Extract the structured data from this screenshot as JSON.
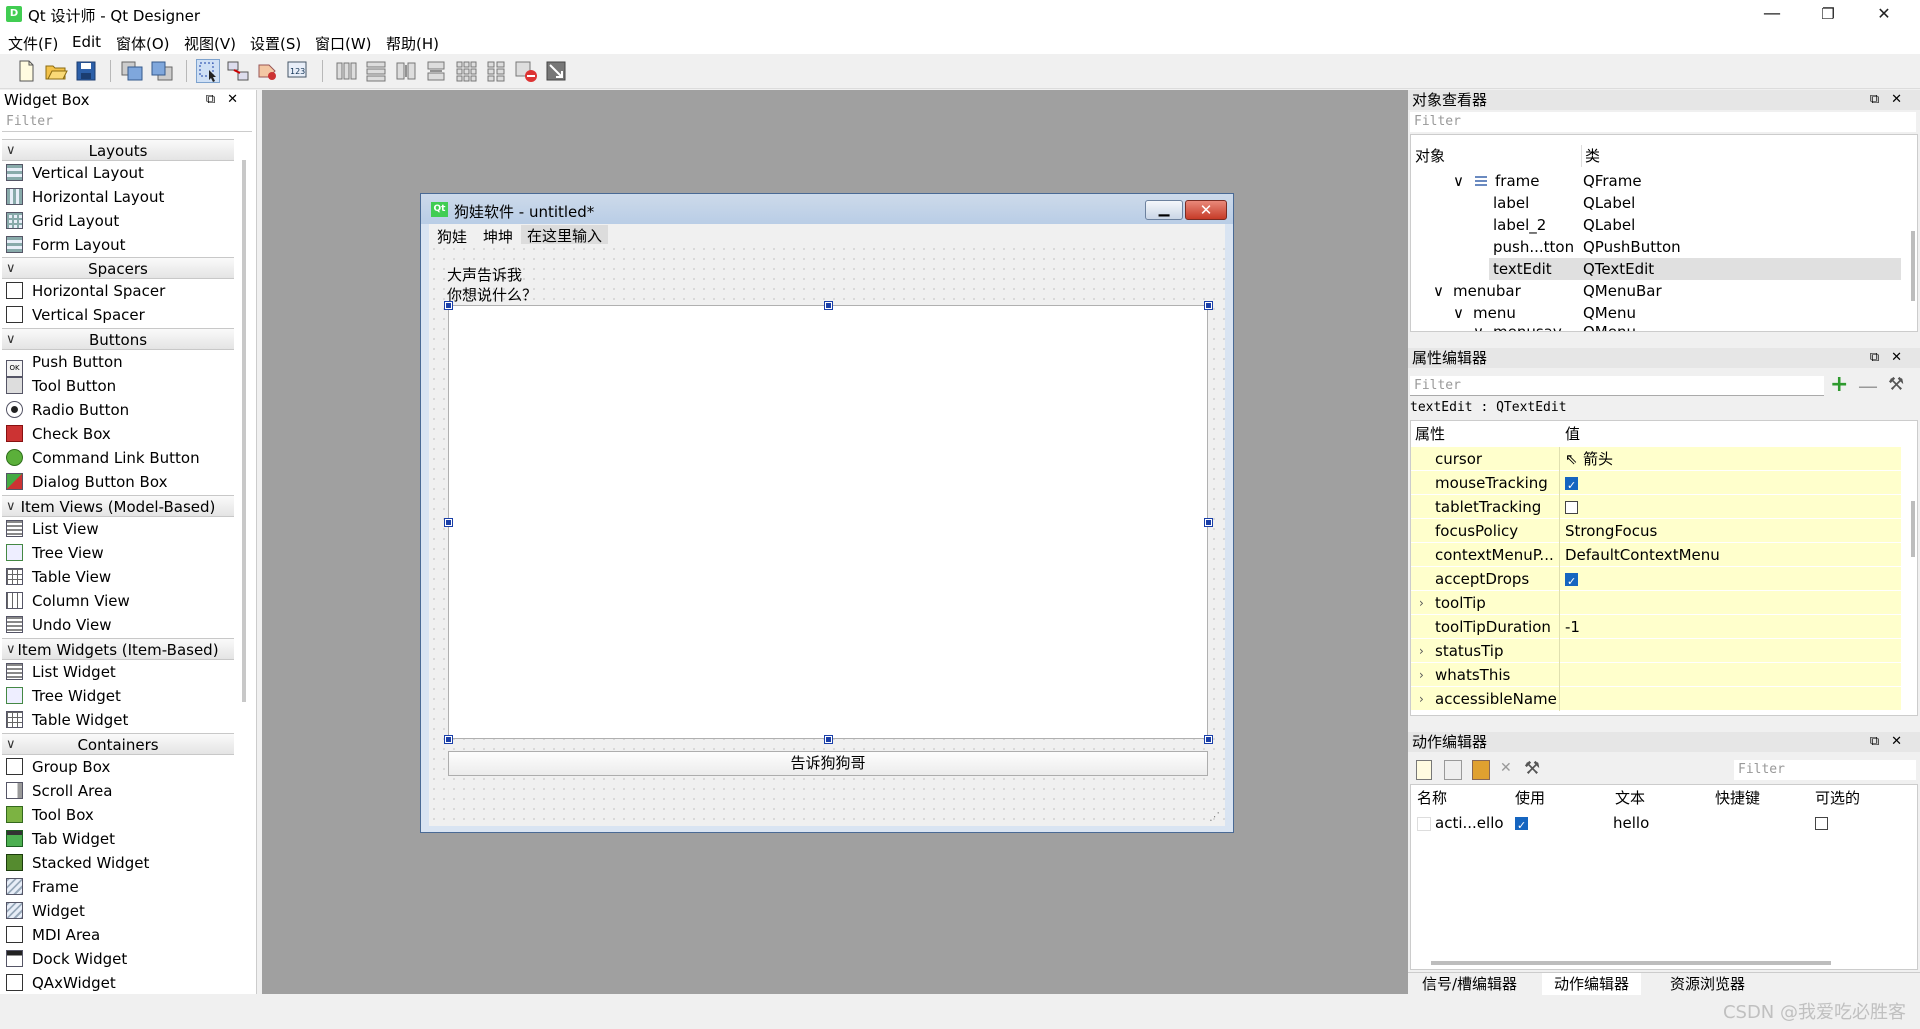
{
  "window": {
    "title": "Qt 设计师 - Qt Designer",
    "icon": "D",
    "minimize": "—",
    "restore": "❐",
    "close": "✕"
  },
  "menu": [
    "文件(F)",
    "Edit",
    "窗体(O)",
    "视图(V)",
    "设置(S)",
    "窗口(W)",
    "帮助(H)"
  ],
  "widget_box": {
    "title": "Widget Box",
    "filter_placeholder": "Filter",
    "categories": {
      "layouts": "Layouts",
      "spacers": "Spacers",
      "buttons": "Buttons",
      "item_views": "Item Views (Model-Based)",
      "item_widgets": "Item Widgets (Item-Based)",
      "containers": "Containers"
    },
    "items": {
      "vertical_layout": "Vertical Layout",
      "horizontal_layout": "Horizontal Layout",
      "grid_layout": "Grid Layout",
      "form_layout": "Form Layout",
      "horizontal_spacer": "Horizontal Spacer",
      "vertical_spacer": "Vertical Spacer",
      "push_button": "Push Button",
      "tool_button": "Tool Button",
      "radio_button": "Radio Button",
      "check_box": "Check Box",
      "command_link_button": "Command Link Button",
      "dialog_button_box": "Dialog Button Box",
      "list_view": "List View",
      "tree_view": "Tree View",
      "table_view": "Table View",
      "column_view": "Column View",
      "undo_view": "Undo View",
      "list_widget": "List Widget",
      "tree_widget": "Tree Widget",
      "table_widget": "Table Widget",
      "group_box": "Group Box",
      "scroll_area": "Scroll Area",
      "tool_box": "Tool Box",
      "tab_widget": "Tab Widget",
      "stacked_widget": "Stacked Widget",
      "frame": "Frame",
      "widget": "Widget",
      "mdi_area": "MDI Area",
      "dock_widget": "Dock Widget",
      "qaxwidget": "QAxWidget"
    }
  },
  "form": {
    "title": "狗娃软件 - untitled*",
    "icon": "Qt",
    "menus": [
      "狗娃",
      "坤坤",
      "在这里输入"
    ],
    "label1": "大声告诉我",
    "label2": "你想说什么？",
    "button": "告诉狗狗哥"
  },
  "object_inspector": {
    "title": "对象查看器",
    "filter_placeholder": "Filter",
    "col_object": "对象",
    "col_class": "类",
    "rows": [
      {
        "name": "frame",
        "cls": "QFrame"
      },
      {
        "name": "label",
        "cls": "QLabel"
      },
      {
        "name": "label_2",
        "cls": "QLabel"
      },
      {
        "name": "push...tton",
        "cls": "QPushButton"
      },
      {
        "name": "textEdit",
        "cls": "QTextEdit"
      },
      {
        "name": "menubar",
        "cls": "QMenuBar"
      },
      {
        "name": "menu",
        "cls": "QMenu"
      },
      {
        "name": "menusav",
        "cls": "QMenu"
      }
    ]
  },
  "property_editor": {
    "title": "属性编辑器",
    "filter_placeholder": "Filter",
    "context": "textEdit : QTextEdit",
    "col_property": "属性",
    "col_value": "值",
    "rows": {
      "cursor": {
        "name": "cursor",
        "value": "箭头"
      },
      "mouseTracking": {
        "name": "mouseTracking",
        "checked": true
      },
      "tabletTracking": {
        "name": "tabletTracking",
        "checked": false
      },
      "focusPolicy": {
        "name": "focusPolicy",
        "value": "StrongFocus"
      },
      "contextMenu": {
        "name": "contextMenuP...",
        "value": "DefaultContextMenu"
      },
      "acceptDrops": {
        "name": "acceptDrops",
        "checked": true
      },
      "toolTip": {
        "name": "toolTip",
        "value": ""
      },
      "toolTipDuration": {
        "name": "toolTipDuration",
        "value": "-1"
      },
      "statusTip": {
        "name": "statusTip",
        "value": ""
      },
      "whatsThis": {
        "name": "whatsThis",
        "value": ""
      },
      "accessibleName": {
        "name": "accessibleName",
        "value": ""
      }
    }
  },
  "action_editor": {
    "title": "动作编辑器",
    "filter_placeholder": "Filter",
    "columns": [
      "名称",
      "使用",
      "文本",
      "快捷键",
      "可选的"
    ],
    "row": {
      "name": "acti...ello",
      "used": true,
      "text": "hello",
      "checkable": false
    }
  },
  "bottom_tabs": [
    "信号/槽编辑器",
    "动作编辑器",
    "资源浏览器"
  ],
  "watermark": "CSDN @我爱吃必胜客",
  "colors": {
    "accent": "#1565c0",
    "property_bg": "#ffffcc",
    "mdi_bg": "#a0a0a0"
  }
}
